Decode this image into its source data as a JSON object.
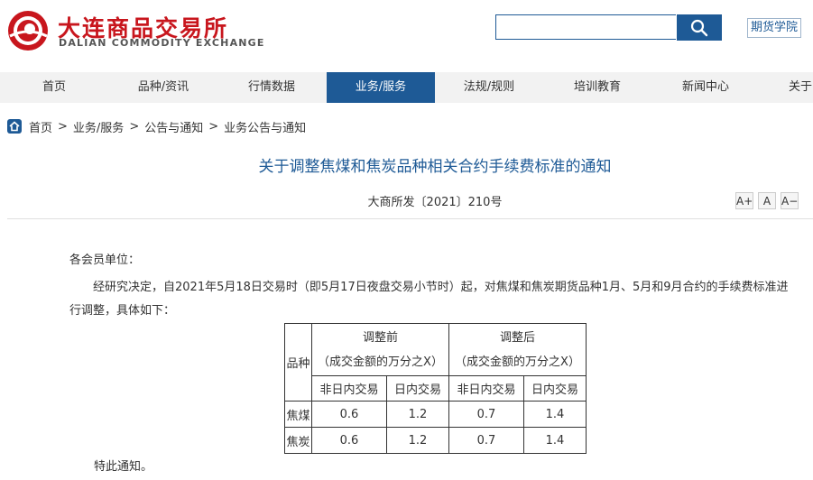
{
  "header": {
    "logo_cn": "大连商品交易所",
    "logo_en": "DALIAN COMMODITY EXCHANGE",
    "search_placeholder": "",
    "futures_academy": "期货学院"
  },
  "colors": {
    "brand_red": "#c8161d",
    "brand_blue": "#1e5a96"
  },
  "nav": {
    "items": [
      {
        "label": "首页"
      },
      {
        "label": "品种/资讯"
      },
      {
        "label": "行情数据"
      },
      {
        "label": "业务/服务",
        "active": true
      },
      {
        "label": "法规/规则"
      },
      {
        "label": "培训教育"
      },
      {
        "label": "新闻中心"
      },
      {
        "label": "关于"
      }
    ]
  },
  "breadcrumb": [
    "首页",
    "业务/服务",
    "公告与通知",
    "业务公告与通知"
  ],
  "article": {
    "title": "关于调整焦煤和焦炭品种相关合约手续费标准的通知",
    "doc_number": "大商所发〔2021〕210号",
    "font_controls": [
      "A+",
      "A",
      "A−"
    ],
    "salutation": "各会员单位：",
    "body": "经研究决定，自2021年5月18日交易时（即5月17日夜盘交易小节时）起，对焦煤和焦炭期货品种1月、5月和9月合约的手续费标准进行调整，具体如下：",
    "closing": "特此通知。",
    "table": {
      "col_variety": "品种",
      "before": "调整前",
      "after": "调整后",
      "unit": "（成交金额的万分之X）",
      "non_intraday": "非日内交易",
      "intraday": "日内交易",
      "rows": [
        {
          "name": "焦煤",
          "before_non": "0.6",
          "before_intra": "1.2",
          "after_non": "0.7",
          "after_intra": "1.4"
        },
        {
          "name": "焦炭",
          "before_non": "0.6",
          "before_intra": "1.2",
          "after_non": "0.7",
          "after_intra": "1.4"
        }
      ]
    }
  }
}
